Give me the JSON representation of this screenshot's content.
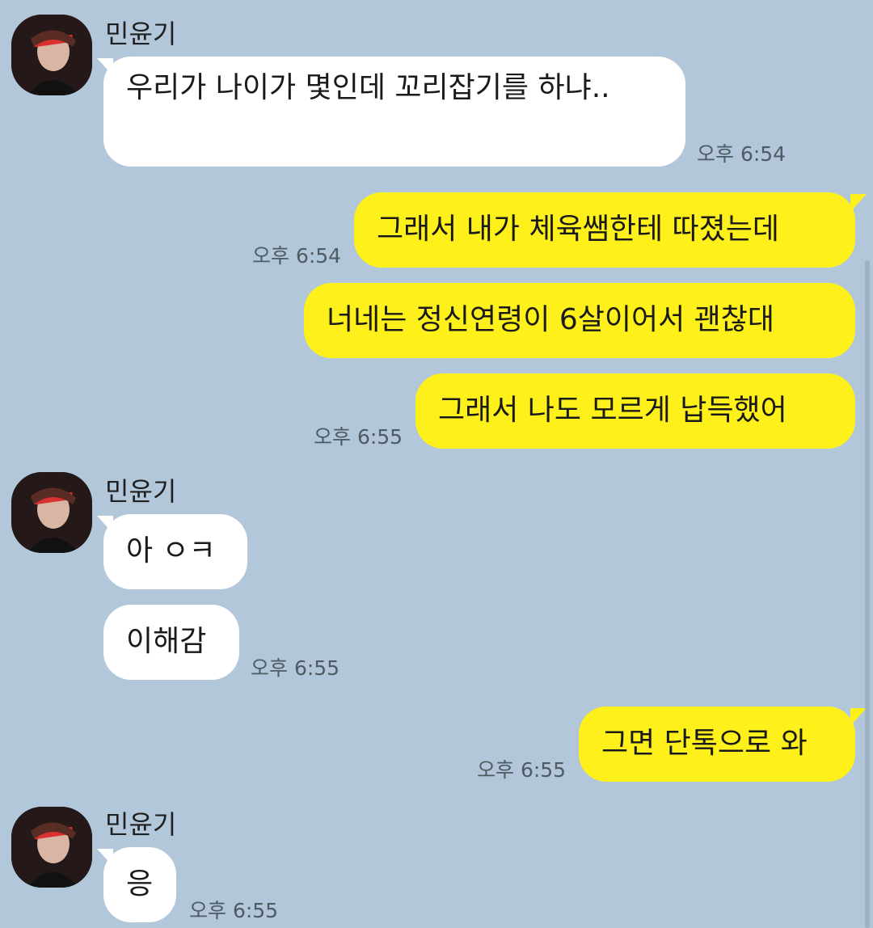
{
  "sender_name": "민윤기",
  "messages": [
    {
      "id": "m1",
      "text": "우리가 나이가 몇인데 꼬리잡기를 하냐..",
      "time": "오후 6:54"
    },
    {
      "id": "m2",
      "text": "그래서 내가 체육쌤한테 따졌는데",
      "time": "오후 6:54"
    },
    {
      "id": "m3",
      "text": "너네는 정신연령이 6살이어서 괜찮대"
    },
    {
      "id": "m4",
      "text": "그래서 나도 모르게 납득했어",
      "time": "오후 6:55"
    },
    {
      "id": "m5",
      "text": "아 ㅇㅋ"
    },
    {
      "id": "m6",
      "text": "이해감",
      "time": "오후 6:55"
    },
    {
      "id": "m7",
      "text": "그면 단톡으로 와",
      "time": "오후 6:55"
    },
    {
      "id": "m8",
      "text": "응",
      "time": "오후 6:55"
    }
  ],
  "colors": {
    "background": "#b2c7da",
    "incoming_bubble": "#ffffff",
    "outgoing_bubble": "#fef01b"
  }
}
